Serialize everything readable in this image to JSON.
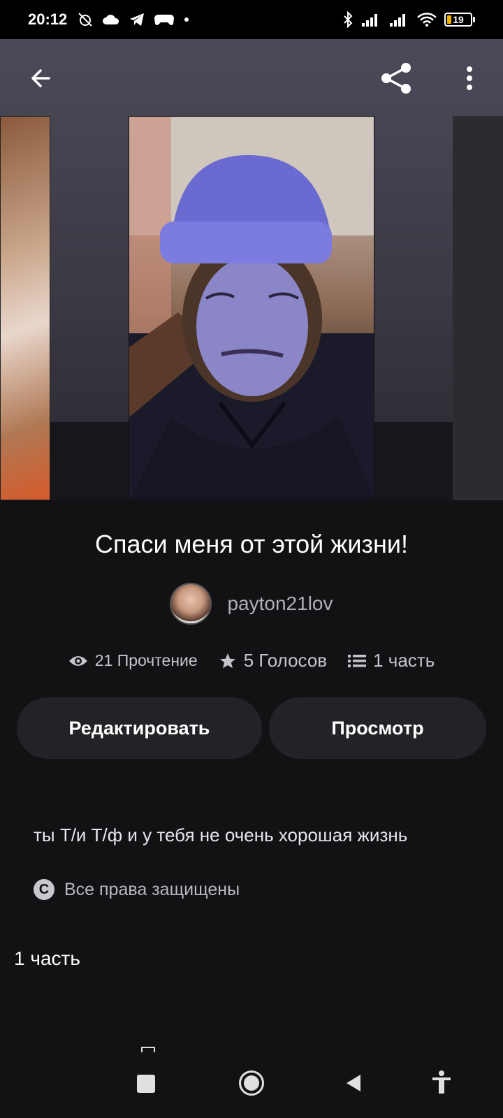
{
  "status_bar": {
    "time": "20:12",
    "battery": "19",
    "battery_level": 0.19,
    "left_icons": [
      "mute-alarm-icon",
      "cloud-icon",
      "telegram-icon",
      "gamepad-icon",
      "dot-icon"
    ],
    "right_icons": [
      "bluetooth-icon",
      "signal-icon",
      "signal-icon",
      "wifi-icon",
      "battery-icon"
    ]
  },
  "header": {
    "back_icon": "arrow-left-icon",
    "share_icon": "share-icon",
    "more_icon": "more-vertical-icon"
  },
  "story": {
    "title": "Спаси меня от этой жизни!",
    "author": "payton21lov",
    "reads": "21 Прочтение",
    "votes": "5 Голосов",
    "parts": "1 часть",
    "description": "ты Т/и Т/ф и у тебя не очень хорошая жизнь",
    "copyright": "Все права защищены"
  },
  "buttons": {
    "edit": "Редактировать",
    "preview": "Просмотр"
  },
  "parts_section": {
    "heading": "1 часть"
  },
  "colors": {
    "background": "#121114",
    "button_bg": "#232226",
    "battery_accent": "#f0b400"
  }
}
